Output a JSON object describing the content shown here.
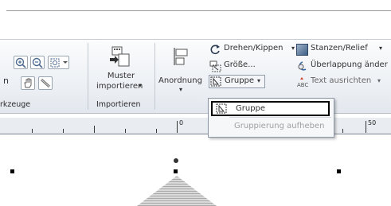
{
  "ribbon": {
    "groups": {
      "werkzeuge": {
        "label": "rkzeuge",
        "partial_letter": "n"
      },
      "importieren": {
        "label": "Importieren",
        "button_line1": "Muster",
        "button_line2": "importieren",
        "caret": "▾"
      },
      "anordnung": {
        "button_label": "Anordnung",
        "caret": "▾",
        "drehen": "Drehen/Kippen",
        "groesse": "Größe...",
        "gruppe": "Gruppe",
        "stanzen": "Stanzen/Relief",
        "ueberlappung": "Überlappung änder",
        "text_ausrichten": "Text ausrichten"
      }
    }
  },
  "dropdown": {
    "items": [
      {
        "label": "Gruppe",
        "enabled": true
      },
      {
        "label": "Gruppierung aufheben",
        "enabled": false
      }
    ]
  },
  "ruler": {
    "labels": [
      "0",
      "50"
    ]
  },
  "colors": {
    "accent_red": "#d03b2f",
    "blue_icon": "#2d5fa8",
    "selection_border": "#000000"
  }
}
